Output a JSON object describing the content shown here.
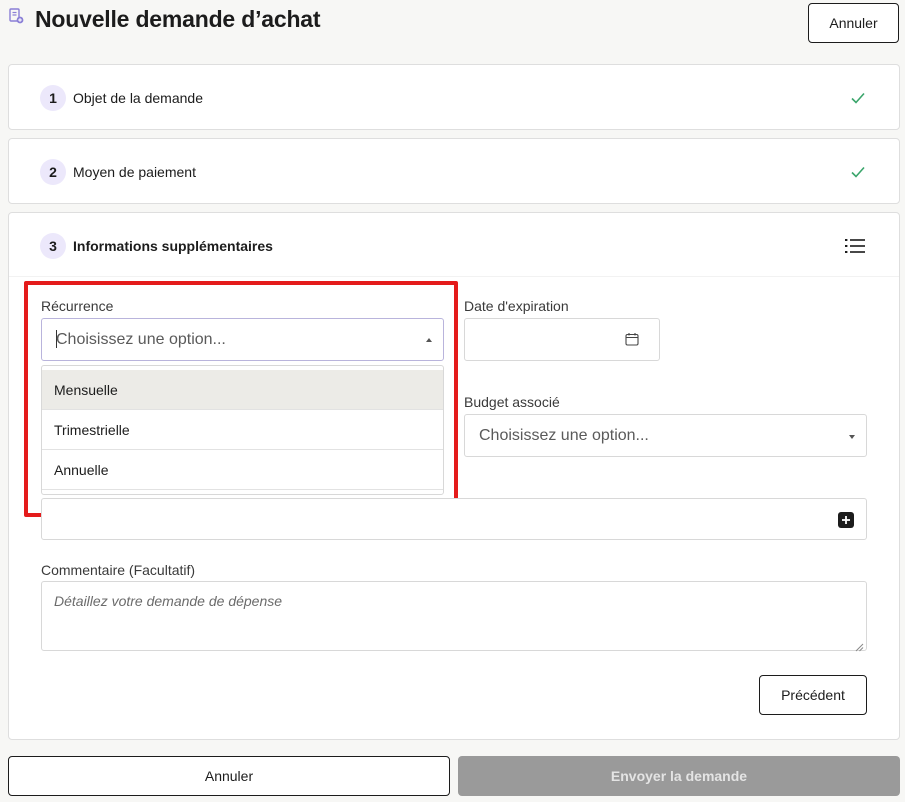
{
  "header": {
    "title": "Nouvelle demande d’achat",
    "icon": "document-plus-icon",
    "cancel_label": "Annuler"
  },
  "steps": [
    {
      "number": "1",
      "label": "Objet de la demande",
      "status_icon": "check-icon",
      "completed": true
    },
    {
      "number": "2",
      "label": "Moyen de paiement",
      "status_icon": "check-icon",
      "completed": true
    },
    {
      "number": "3",
      "label": "Informations supplémentaires",
      "status_icon": "list-icon",
      "completed": false
    }
  ],
  "form": {
    "recurrence": {
      "label": "Récurrence",
      "placeholder": "Choisissez une option...",
      "options": [
        "Mensuelle",
        "Trimestrielle",
        "Annuelle"
      ],
      "hovered_option": "Mensuelle",
      "open": true
    },
    "expiration_date": {
      "label": "Date d'expiration",
      "value": "",
      "icon": "calendar-icon"
    },
    "budget": {
      "label": "Budget associé",
      "placeholder": "Choisissez une option..."
    },
    "attachments": {
      "icon": "plus-icon"
    },
    "comment": {
      "label": "Commentaire (Facultatif)",
      "placeholder": "Détaillez votre demande de dépense"
    },
    "previous_label": "Précédent"
  },
  "footer": {
    "cancel_label": "Annuler",
    "submit_label": "Envoyer la demande",
    "submit_disabled": true
  },
  "colors": {
    "highlight": "#e41b1b",
    "check": "#3aa56b",
    "step_badge": "#ece8fb",
    "disabled_button": "#9a9a9a"
  }
}
